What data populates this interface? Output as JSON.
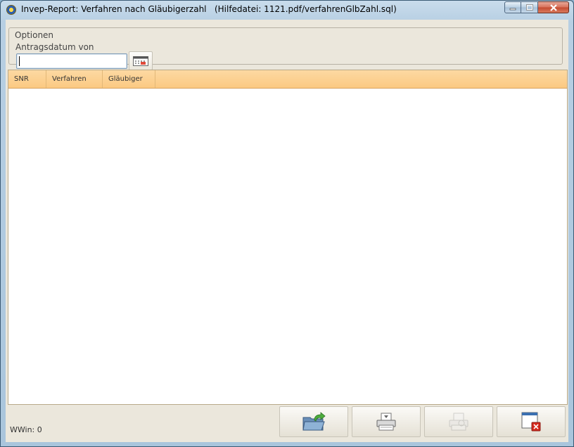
{
  "window": {
    "title": "Invep-Report: Verfahren nach Gläubigerzahl   (Hilfedatei: 1121.pdf/verfahrenGlbZahl.sql)"
  },
  "options": {
    "group_label": "Optionen",
    "date_label": "Antragsdatum von",
    "date_value": ""
  },
  "table": {
    "columns": [
      "SNR",
      "Verfahren",
      "Gläubiger"
    ],
    "rows": []
  },
  "status": {
    "wwin_text": "WWin: 0"
  },
  "icons": {
    "app": "app-icon",
    "calendar": "calendar-icon",
    "export": "export-folder-icon",
    "print": "printer-icon",
    "print_disabled": "print-preview-icon",
    "close": "close-window-icon"
  },
  "colors": {
    "header_bg": "#fbc982",
    "window_bg": "#ebe7dc",
    "input_border": "#7f9db9"
  }
}
